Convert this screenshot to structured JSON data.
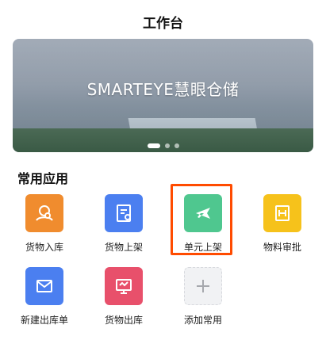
{
  "header": {
    "title": "工作台"
  },
  "banner": {
    "text": "SMARTEYE慧眼仓储",
    "slides": 3,
    "active_slide": 1
  },
  "section": {
    "title": "常用应用"
  },
  "apps": [
    {
      "label": "货物入库",
      "icon": "goods-inbound-icon",
      "color": "#f08c2e"
    },
    {
      "label": "货物上架",
      "icon": "goods-shelving-icon",
      "color": "#4b7ff0"
    },
    {
      "label": "单元上架",
      "icon": "airplane-icon",
      "color": "#4fc78f",
      "highlighted": true
    },
    {
      "label": "物料审批",
      "icon": "material-approval-icon",
      "color": "#f6c21b"
    },
    {
      "label": "新建出库单",
      "icon": "mail-icon",
      "color": "#4b7ff0"
    },
    {
      "label": "货物出库",
      "icon": "presentation-board-icon",
      "color": "#e8506b"
    },
    {
      "label": "添加常用",
      "icon": "plus-icon",
      "color": "#f1f2f4"
    }
  ],
  "colors": {
    "highlight_border": "#ff4b00"
  }
}
